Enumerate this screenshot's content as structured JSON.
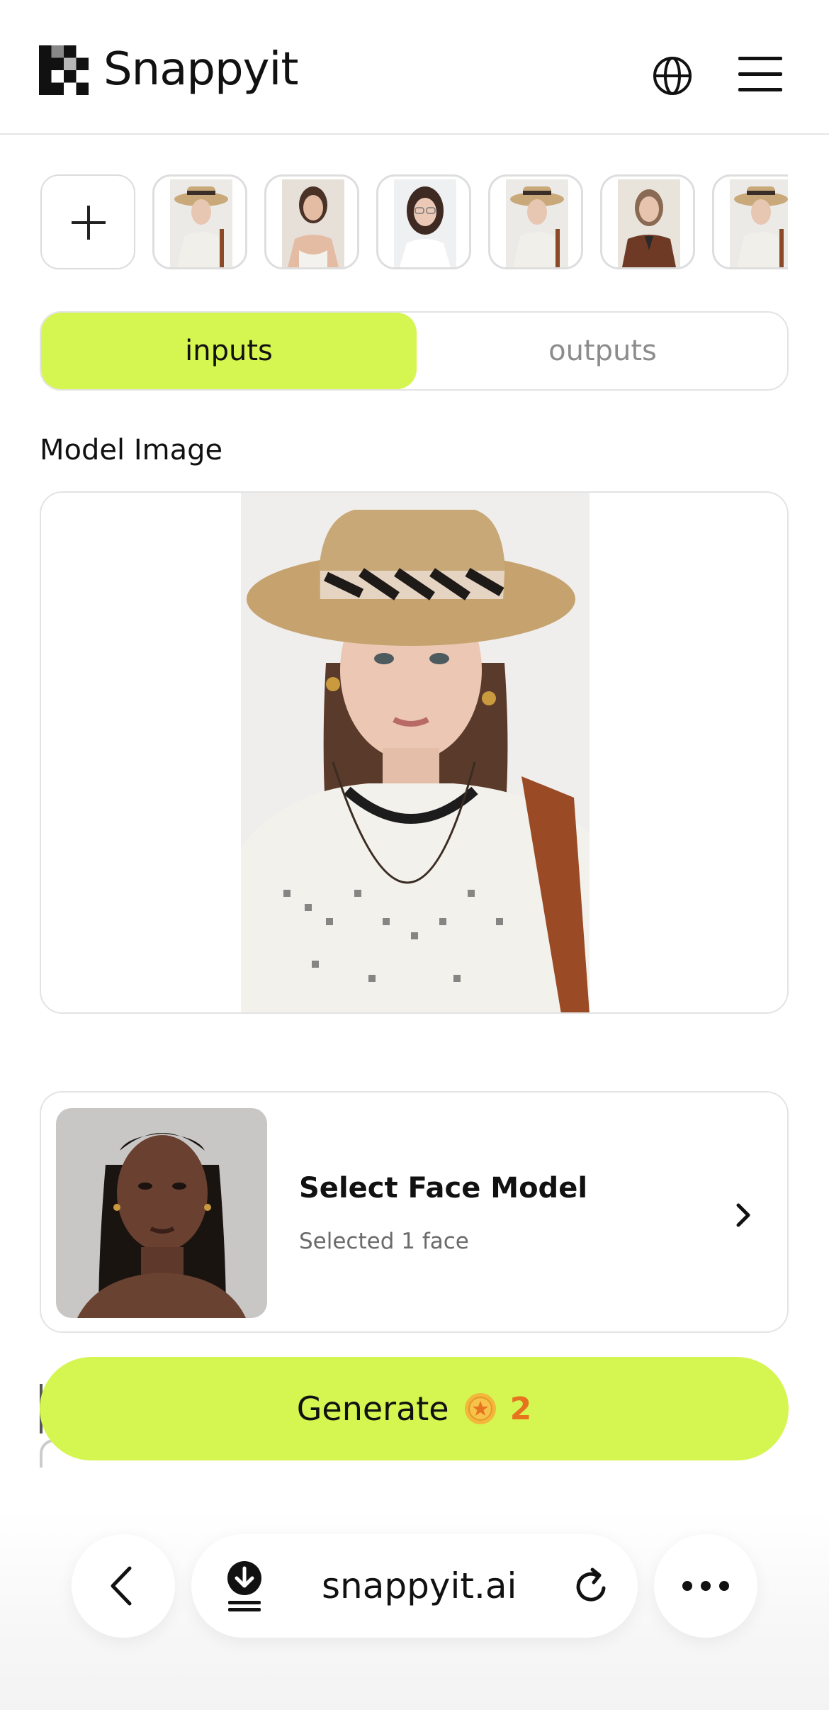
{
  "header": {
    "brand": "Snappyit",
    "logo_icon": "checker-logo-icon",
    "globe_icon": "globe-icon",
    "menu_icon": "hamburger-menu-icon"
  },
  "thumbnails": {
    "add_icon": "plus-icon",
    "items": [
      {
        "name": "hat-model"
      },
      {
        "name": "brunette-model"
      },
      {
        "name": "glasses-model"
      },
      {
        "name": "hat-model-2"
      },
      {
        "name": "blazer-model"
      },
      {
        "name": "hat-model-3"
      }
    ]
  },
  "tabs": {
    "inputs": "inputs",
    "outputs": "outputs",
    "active": "inputs"
  },
  "model_section": {
    "label": "Model Image"
  },
  "face_model": {
    "title": "Select Face Model",
    "subtitle": "Selected 1 face",
    "chevron_icon": "chevron-right-icon"
  },
  "generate": {
    "label": "Generate",
    "cost": "2",
    "coin_icon": "coin-icon"
  },
  "browser_bar": {
    "url": "snappyit.ai",
    "back_icon": "back-arrow-icon",
    "download_icon": "download-icon",
    "reload_icon": "reload-icon",
    "more_icon": "more-dots-icon"
  },
  "colors": {
    "accent": "#d5f551",
    "cost": "#e8731e",
    "muted": "#8c8c8c"
  }
}
